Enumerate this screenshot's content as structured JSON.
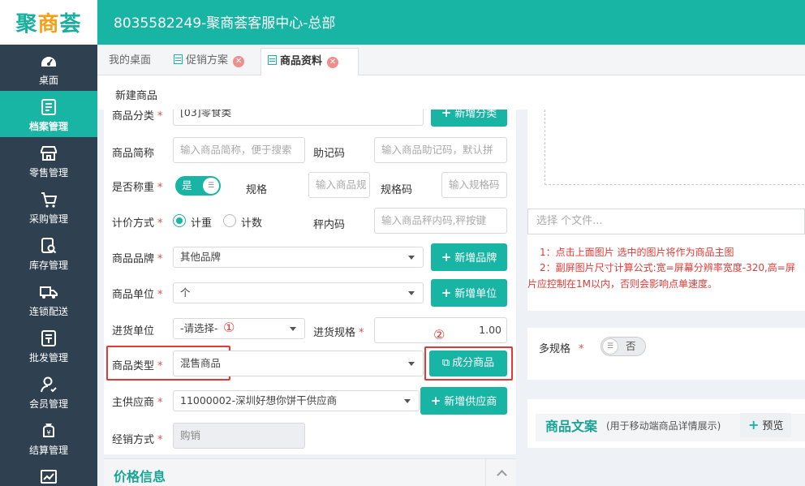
{
  "app": {
    "logo": "聚商荟",
    "shop_title": "8035582249-聚商荟客服中心-总部"
  },
  "sidebar": {
    "items": [
      {
        "label": "桌面",
        "icon": "dashboard-icon",
        "active": false
      },
      {
        "label": "档案管理",
        "icon": "archive-icon",
        "active": true
      },
      {
        "label": "零售管理",
        "icon": "store-icon",
        "active": false
      },
      {
        "label": "采购管理",
        "icon": "cart-icon",
        "active": false
      },
      {
        "label": "库存管理",
        "icon": "inventory-search-icon",
        "active": false
      },
      {
        "label": "连锁配送",
        "icon": "truck-icon",
        "active": false
      },
      {
        "label": "批发管理",
        "icon": "wholesale-icon",
        "active": false
      },
      {
        "label": "会员管理",
        "icon": "member-icon",
        "active": false
      },
      {
        "label": "结算管理",
        "icon": "settlement-icon",
        "active": false
      },
      {
        "label": "",
        "icon": "report-chart-icon",
        "active": false
      }
    ]
  },
  "tabs": [
    {
      "label": "我的桌面",
      "closable": false
    },
    {
      "label": "促销方案",
      "closable": true
    },
    {
      "label": "商品资料",
      "closable": true,
      "active": true
    }
  ],
  "subheader": {
    "title": "新建商品"
  },
  "form": {
    "category": {
      "label": "商品分类",
      "value": "[03]零食类",
      "button": "新增分类"
    },
    "short_name": {
      "label": "商品简称",
      "placeholder": "输入商品简称，便于搜索"
    },
    "mnemonic": {
      "label": "助记码",
      "placeholder": "输入商品助记码，默认拼"
    },
    "weighed": {
      "label": "是否称重",
      "toggle": "是"
    },
    "spec": {
      "label": "规格",
      "placeholder": "输入商品规"
    },
    "spec_code": {
      "label": "规格码",
      "placeholder": "输入规格码"
    },
    "pricing": {
      "label": "计价方式",
      "options": [
        "计重",
        "计数"
      ],
      "selected": "计重"
    },
    "scale_code": {
      "label": "秤内码",
      "placeholder": "输入商品秤内码,秤按键"
    },
    "brand": {
      "label": "商品品牌",
      "value": "其他品牌",
      "button": "新增品牌"
    },
    "unit": {
      "label": "商品单位",
      "value": "个",
      "button": "新增单位"
    },
    "purchase_unit": {
      "label": "进货单位",
      "value": "-请选择-"
    },
    "purchase_spec": {
      "label": "进货规格",
      "value": "1.00"
    },
    "product_type": {
      "label": "商品类型",
      "value": "混售商品",
      "button": "成分商品"
    },
    "supplier": {
      "label": "主供应商",
      "value": "11000002-深圳好想你饼干供应商",
      "button": "新增供应商"
    },
    "sales_mode": {
      "label": "经销方式",
      "value": "购销"
    }
  },
  "annotations": {
    "mark1": "①",
    "mark2": "②"
  },
  "section_price": {
    "title": "价格信息"
  },
  "image_panel": {
    "file_placeholder": "选择 个文件...",
    "tip1": "1：点击上面图片 选中的图片将作为商品主图",
    "tip2": "2：副屏图片尺寸计算公式:宽=屏幕分辨率宽度-320,高=屏",
    "tip3": "片应控制在1M以内，否则会影响点单速度。"
  },
  "multi_spec": {
    "label": "多规格",
    "toggle": "否"
  },
  "copywriting": {
    "title": "商品文案",
    "subtitle": "(用于移动端商品详情展示)",
    "button": "预览"
  },
  "colors": {
    "primary": "#18b5a5",
    "sidebar": "#2f4050",
    "required": "#e94b4b",
    "highlight": "#e53935"
  }
}
